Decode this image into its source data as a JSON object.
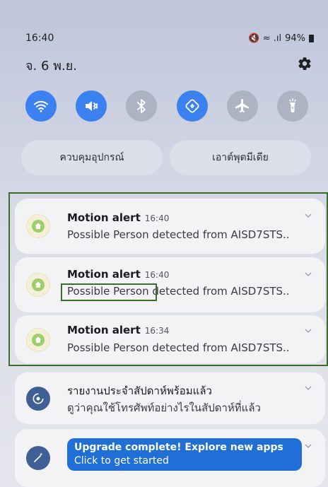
{
  "status": {
    "time": "16:40",
    "icons_label": "🔇 ≈ .ıl",
    "battery": "94%"
  },
  "header": {
    "date": "จ. 6 พ.ย.",
    "settings_icon": "gear-icon"
  },
  "quick_settings": [
    {
      "name": "wifi-icon",
      "state": "on"
    },
    {
      "name": "mute-icon",
      "state": "on"
    },
    {
      "name": "bluetooth-icon",
      "state": "off"
    },
    {
      "name": "auto-rotate-icon",
      "state": "on"
    },
    {
      "name": "airplane-icon",
      "state": "off"
    },
    {
      "name": "flashlight-icon",
      "state": "off"
    }
  ],
  "pills": {
    "device_control": "ควบคุมอุปกรณ์",
    "media_output": "เอาต์พุตมีเดีย"
  },
  "notifications": [
    {
      "title": "Motion alert",
      "time": "16:40",
      "text": "Possible Person detected from AISD7STS.."
    },
    {
      "title": "Motion alert",
      "time": "16:40",
      "text_highlight": "Possible Person",
      "text_rest": " detected from AISD7STS.."
    },
    {
      "title": "Motion alert",
      "time": "16:34",
      "text": "Possible Person detected from AISD7STS.."
    }
  ],
  "weekly_report": {
    "title": "รายงานประจำสัปดาห์พร้อมแล้ว",
    "text": "ดูว่าคุณใช้โทรศัพท์อย่างไรในสัปดาห์ที่แล้ว"
  },
  "upgrade": {
    "title": "Upgrade complete! Explore new apps",
    "text": "Click to get started"
  },
  "colors": {
    "accent_blue": "#3b82f0",
    "highlight_green": "#3b6e2d",
    "banner_blue": "#1f6fd6"
  }
}
